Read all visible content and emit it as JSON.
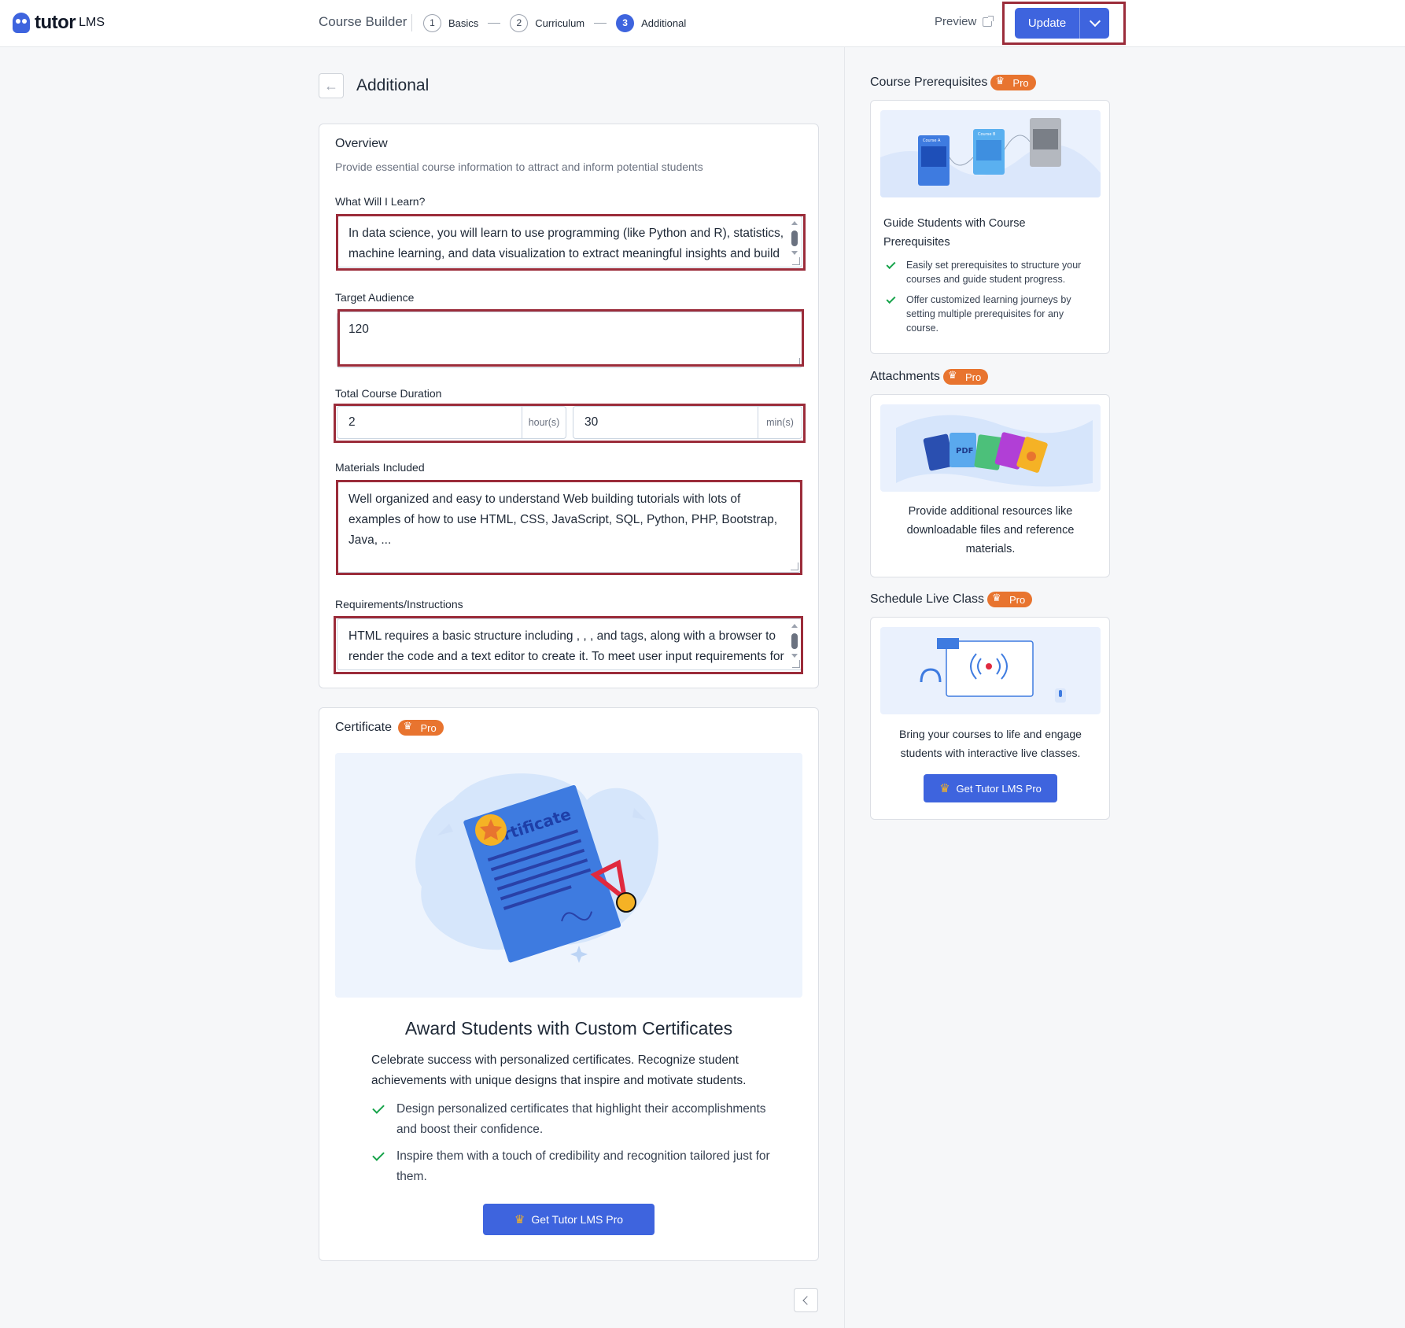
{
  "header": {
    "logo_text": "tutor",
    "logo_sub": "LMS",
    "builder_title": "Course Builder",
    "steps": [
      {
        "num": "1",
        "label": "Basics"
      },
      {
        "num": "2",
        "label": "Curriculum"
      },
      {
        "num": "3",
        "label": "Additional"
      }
    ],
    "preview_label": "Preview",
    "update_label": "Update"
  },
  "page": {
    "title": "Additional"
  },
  "overview": {
    "title": "Overview",
    "subtitle": "Provide essential course information to attract and inform potential students",
    "learn_label": "What Will I Learn?",
    "learn_value": "In data science, you will learn to use programming (like Python and R), statistics, machine learning, and data visualization to extract meaningful insights and build predictive models from large datasets. This includes",
    "audience_label": "Target Audience",
    "audience_value": "120",
    "duration_label": "Total Course Duration",
    "duration_hours": "2",
    "hours_unit": "hour(s)",
    "duration_mins": "30",
    "mins_unit": "min(s)",
    "materials_label": "Materials Included",
    "materials_value": "Well organized and easy to understand Web building tutorials with lots of examples of how to use HTML, CSS, JavaScript, SQL, Python, PHP, Bootstrap, Java, ...",
    "requirements_label": "Requirements/Instructions",
    "requirements_value": "HTML requires a basic structure including , , , and  tags, along with a browser to render the code and a text editor to create it. To meet user input requirements for forms, the required attribute should be added to input fields"
  },
  "certificate": {
    "title": "Certificate",
    "pro": "Pro",
    "illus_word": "Certificate",
    "heading": "Award Students with Custom Certificates",
    "description": "Celebrate success with personalized certificates. Recognize student achievements with unique designs that inspire and motivate students.",
    "bullets": [
      "Design personalized certificates that highlight their accomplishments and boost their confidence.",
      "Inspire them with a touch of credibility and recognition tailored just for them."
    ],
    "button": "Get Tutor LMS Pro"
  },
  "sidebar": {
    "prerequisites": {
      "title": "Course Prerequisites",
      "pro": "Pro",
      "illus_a": "Course A",
      "illus_b": "Course B",
      "heading": "Guide Students with Course Prerequisites",
      "bullets": [
        "Easily set prerequisites to structure your courses and guide student progress.",
        "Offer customized learning journeys by setting multiple prerequisites for any course."
      ]
    },
    "attachments": {
      "title": "Attachments",
      "pro": "Pro",
      "illus_pdf": "PDF",
      "description": "Provide additional resources like downloadable files and reference materials."
    },
    "live_class": {
      "title": "Schedule Live Class",
      "pro": "Pro",
      "description": "Bring your courses to life and engage students with interactive live classes.",
      "button": "Get Tutor LMS Pro"
    }
  },
  "colors": {
    "primary": "#3e64de",
    "pro_badge": "#e8742f",
    "highlight_border": "#9b2c3a",
    "check": "#16a34a"
  }
}
